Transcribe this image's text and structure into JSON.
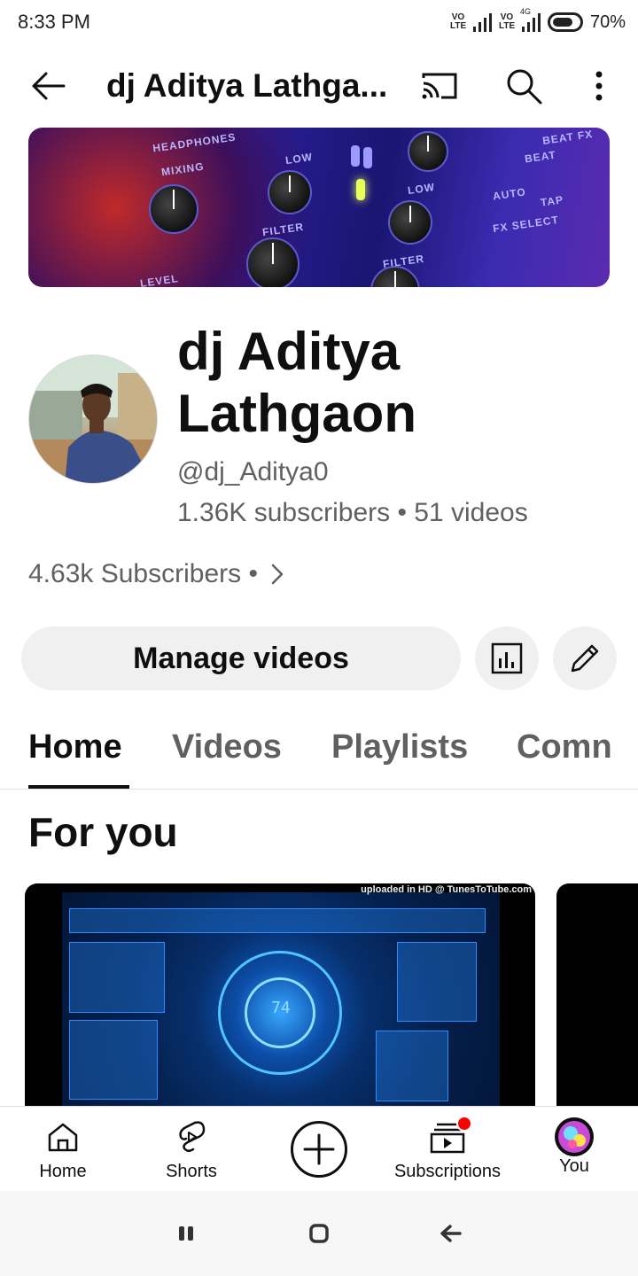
{
  "status_bar": {
    "time": "8:33 PM",
    "volte_1": "VO\nLTE",
    "volte_2": "VO\nLTE",
    "network_label": "4G",
    "battery": "70%",
    "battery_level": 0.7
  },
  "app_bar": {
    "title": "dj Aditya Lathga...",
    "back_icon": "arrow-left-icon",
    "cast_icon": "cast-icon",
    "search_icon": "search-icon",
    "more_icon": "more-vert-icon"
  },
  "banner": {
    "labels": [
      "HEADPHONES",
      "MIXING",
      "LOW",
      "FILTER",
      "LOW",
      "FILTER",
      "BEAT FX",
      "BEAT",
      "AUTO",
      "TAP",
      "FX SELECT",
      "LEVEL"
    ]
  },
  "channel": {
    "name": "dj Aditya Lathgaon",
    "handle": "@dj_Aditya0",
    "stats": "1.36K subscribers • 51 videos",
    "subscribers_line": "4.63k Subscribers •"
  },
  "actions": {
    "manage_label": "Manage videos",
    "analytics_icon": "bar-chart-icon",
    "edit_icon": "pencil-icon"
  },
  "tabs": [
    {
      "label": "Home",
      "active": true
    },
    {
      "label": "Videos",
      "active": false
    },
    {
      "label": "Playlists",
      "active": false
    },
    {
      "label": "Comn",
      "active": false
    }
  ],
  "section": {
    "title": "For you"
  },
  "video": {
    "watermark": "uploaded in HD @ TunesToTube.com",
    "readout": "74"
  },
  "bottom_nav": [
    {
      "label": "Home",
      "icon": "home-icon"
    },
    {
      "label": "Shorts",
      "icon": "shorts-icon"
    },
    {
      "label": "",
      "icon": "create-plus-icon"
    },
    {
      "label": "Subscriptions",
      "icon": "subscriptions-icon"
    },
    {
      "label": "You",
      "icon": "avatar-icon"
    }
  ],
  "colors": {
    "accent_red": "#ff0000",
    "text_primary": "#0f0f0f",
    "text_secondary": "#606060",
    "chip_bg": "#f0f0f0"
  }
}
